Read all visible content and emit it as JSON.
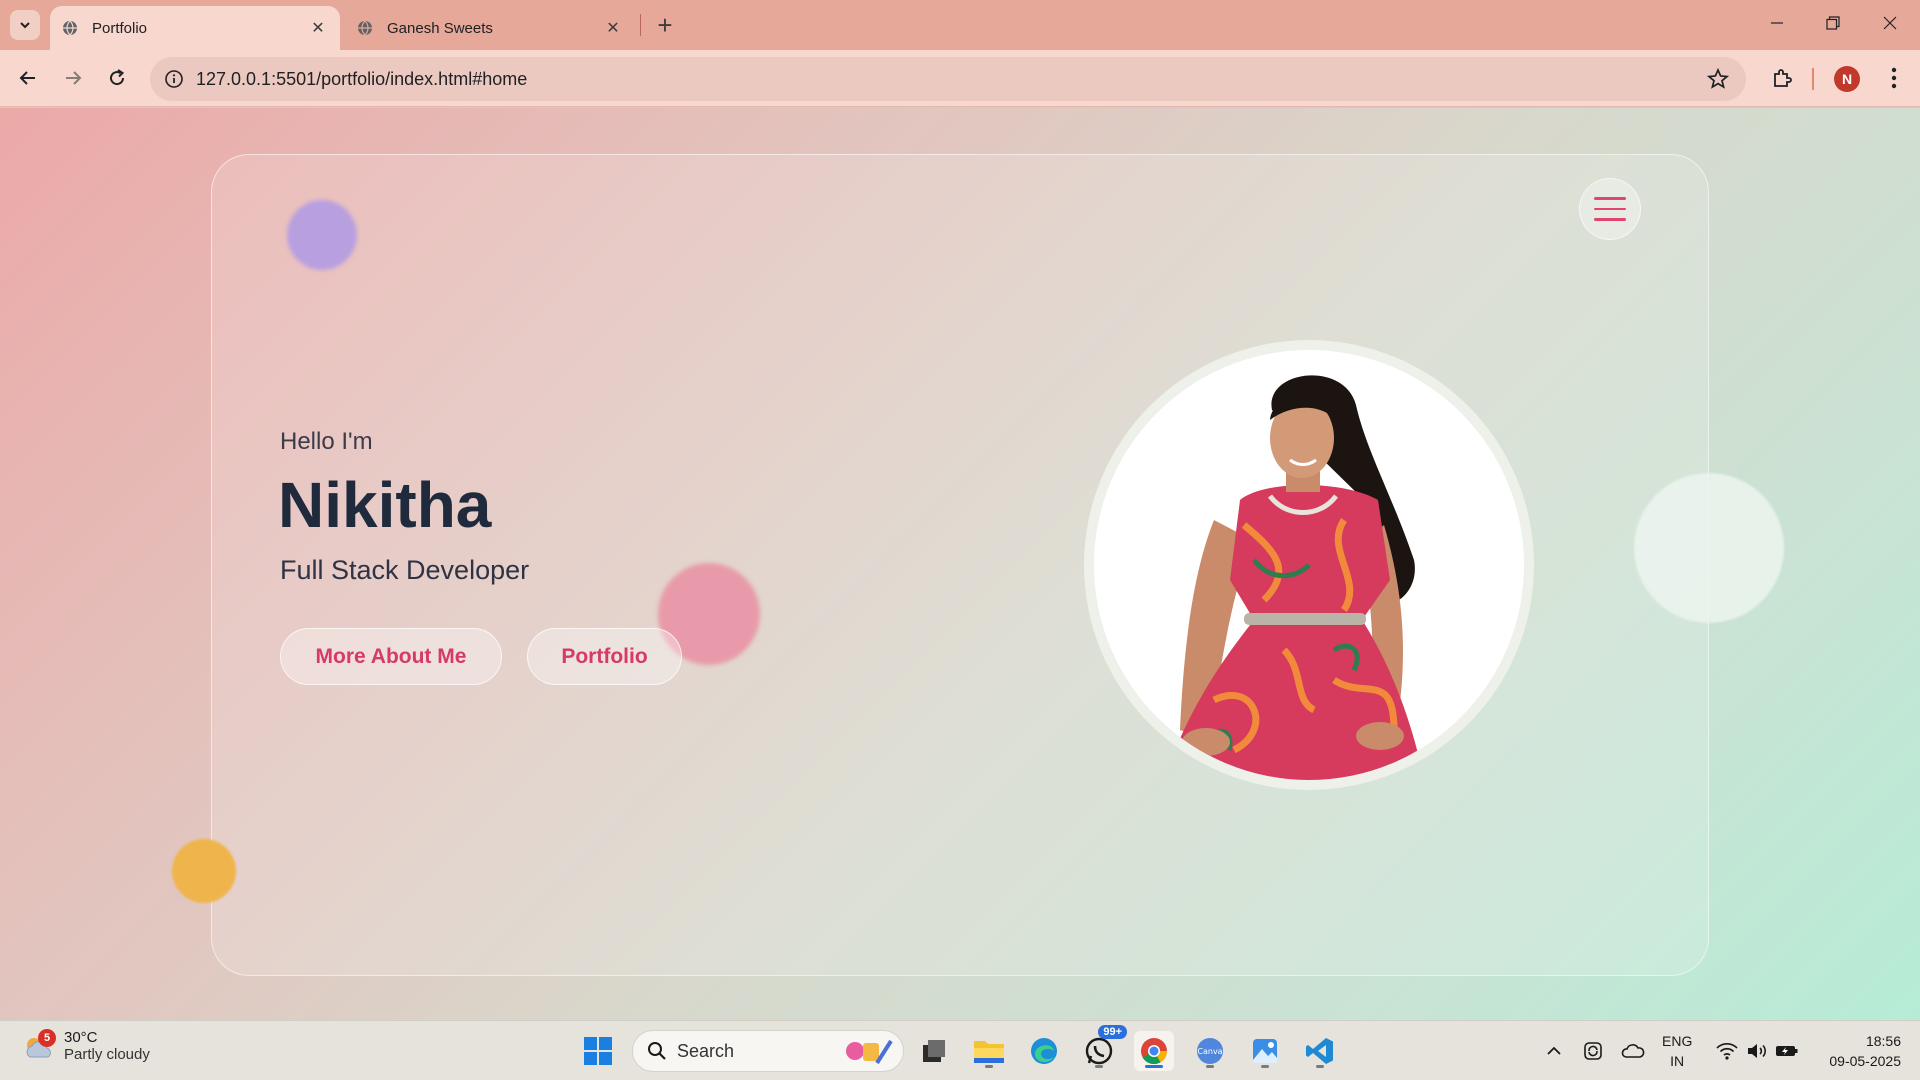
{
  "browser": {
    "tabs": [
      {
        "title": "Portfolio",
        "active": true
      },
      {
        "title": "Ganesh Sweets",
        "active": false
      }
    ],
    "url": "127.0.0.1:5501/portfolio/index.html#home",
    "profile_initial": "N"
  },
  "page": {
    "greeting": "Hello I'm",
    "name": "Nikitha",
    "role": "Full Stack Developer",
    "buttons": {
      "about": "More About Me",
      "portfolio": "Portfolio"
    },
    "colors": {
      "accent": "#d63a66",
      "heading": "#1f2a3c"
    }
  },
  "taskbar": {
    "weather": {
      "temp": "30°C",
      "condition": "Partly cloudy",
      "badge": "5"
    },
    "search_placeholder": "Search",
    "whatsapp_badge": "99+",
    "language": {
      "line1": "ENG",
      "line2": "IN"
    },
    "clock": {
      "time": "18:56",
      "date": "09-05-2025"
    }
  }
}
